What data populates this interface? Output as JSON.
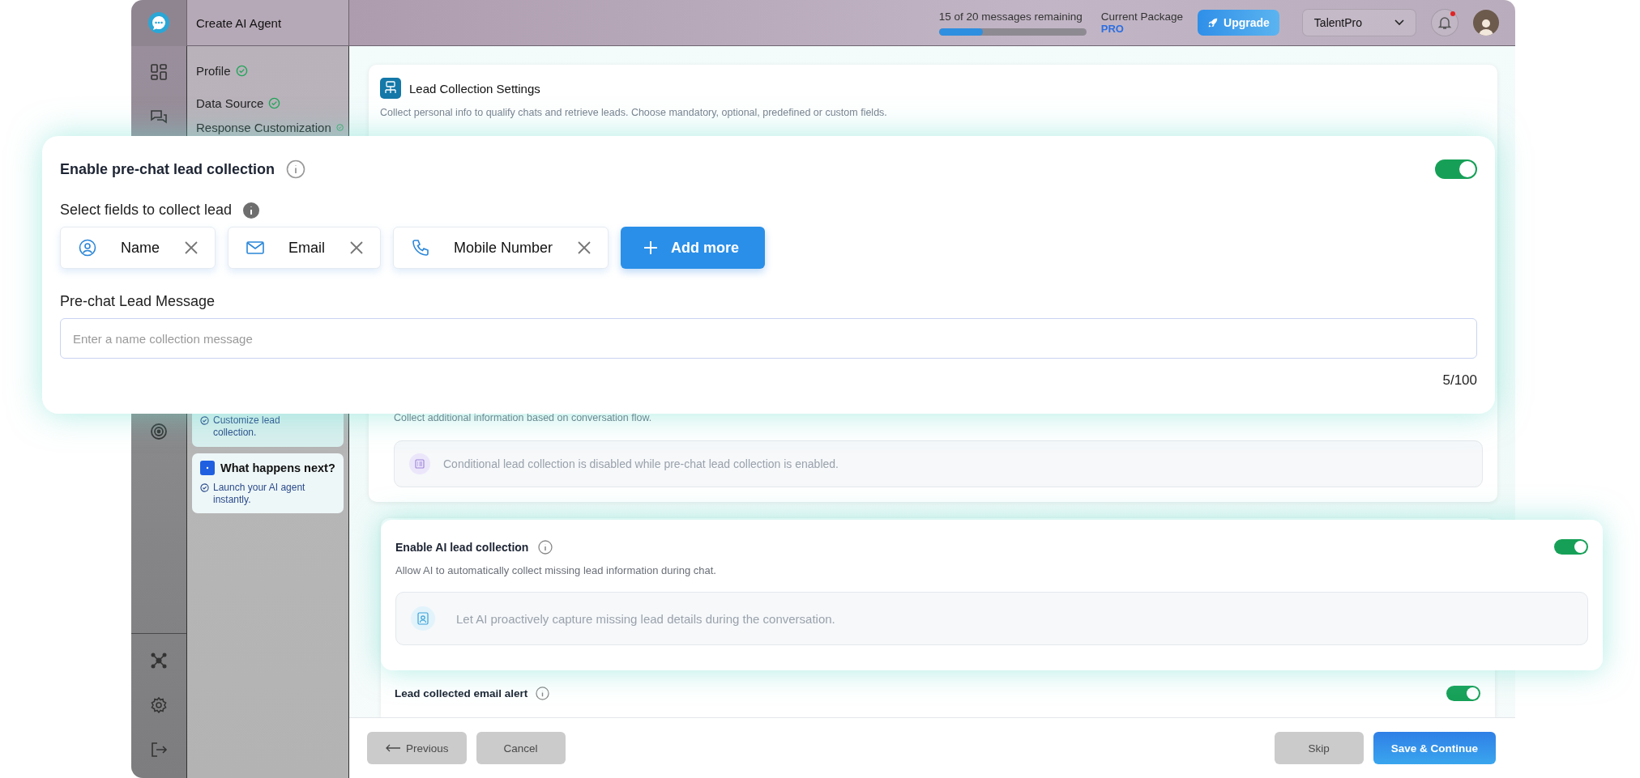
{
  "app": {
    "title": "Create AI Agent"
  },
  "usage": {
    "text": "15 of 20 messages remaining",
    "level": 0.3
  },
  "package": {
    "label": "Current Package",
    "plan": "PRO"
  },
  "upgrade": "Upgrade",
  "workspace": "TalentPro",
  "notifications": {
    "unread": true
  },
  "steps": [
    {
      "label": "Profile",
      "done": true
    },
    {
      "label": "Data Source",
      "done": true
    },
    {
      "label": "Response Customization",
      "done": true
    }
  ],
  "step_cards": [
    {
      "items": [
        "Customize lead collection."
      ]
    },
    {
      "title": "What happens next?",
      "items": [
        "Launch your AI agent instantly."
      ]
    }
  ],
  "settings": {
    "title": "Lead Collection Settings",
    "description": "Collect personal info to qualify chats and retrieve leads. Choose mandatory, optional, predefined or custom fields."
  },
  "pre_chat": {
    "title": "Enable pre-chat lead collection",
    "on": true,
    "fields_label": "Select fields to collect lead",
    "fields": [
      {
        "kind": "person",
        "label": "Name"
      },
      {
        "kind": "mail",
        "label": "Email"
      },
      {
        "kind": "phone",
        "label": "Mobile Number"
      }
    ],
    "add_button": "Add more",
    "message_label": "Pre-chat Lead Message",
    "message": {
      "placeholder": "Enter a name collection message"
    },
    "counter": "5/100"
  },
  "conditional": {
    "description": "Collect additional information based on conversation flow.",
    "notice": "Conditional lead collection is disabled while pre-chat lead collection is enabled."
  },
  "ai": {
    "title": "Enable AI lead collection",
    "on": true,
    "description": "Allow AI to automatically collect missing lead information during chat.",
    "notice": "Let AI proactively capture missing lead details during the conversation."
  },
  "email_alert": {
    "title": "Lead collected email alert",
    "on": true
  },
  "footer": {
    "left": [
      {
        "kind": "back",
        "label": "Previous",
        "disabled": true
      },
      {
        "kind": "plain",
        "label": "Cancel",
        "disabled": true
      }
    ],
    "right": [
      {
        "kind": "plain",
        "label": "Skip",
        "disabled": true
      },
      {
        "kind": "primary",
        "label": "Save & Continue",
        "disabled": false
      }
    ]
  }
}
